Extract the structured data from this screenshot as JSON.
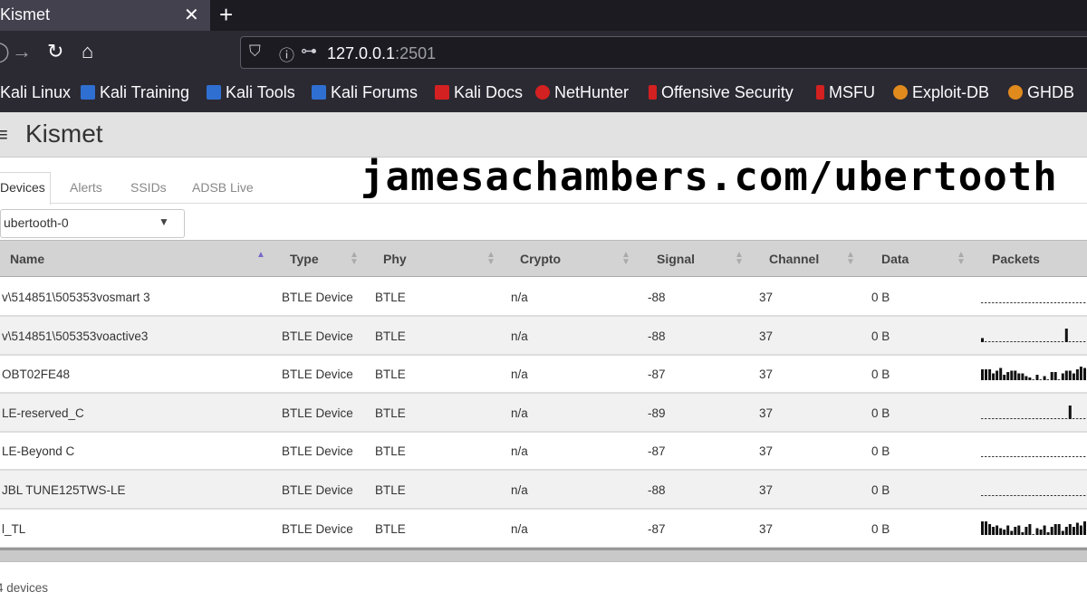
{
  "browser": {
    "tab_title": "Kismet",
    "url_host": "127.0.0.1",
    "url_port": ":2501",
    "bookmarks": [
      {
        "label": "Kali Linux",
        "icon": "none"
      },
      {
        "label": "Kali Training",
        "icon": "kali-dragon-icon"
      },
      {
        "label": "Kali Tools",
        "icon": "kali-dragon-icon"
      },
      {
        "label": "Kali Forums",
        "icon": "kali-dragon-icon"
      },
      {
        "label": "Kali Docs",
        "icon": "red-docs-icon"
      },
      {
        "label": "NetHunter",
        "icon": "nethunter-icon"
      },
      {
        "label": "Offensive Security",
        "icon": "offsec-icon"
      },
      {
        "label": "MSFU",
        "icon": "offsec-icon"
      },
      {
        "label": "Exploit-DB",
        "icon": "exploit-db-icon"
      },
      {
        "label": "GHDB",
        "icon": "exploit-db-icon"
      }
    ]
  },
  "app": {
    "title": "Kismet",
    "tabs": [
      "Devices",
      "Alerts",
      "SSIDs",
      "ADSB Live"
    ],
    "active_tab": "Devices",
    "watermark": "jamesachambers.com/ubertooth",
    "source": "ubertooth-0",
    "device_count": "4 devices"
  },
  "table": {
    "columns": [
      "Name",
      "Type",
      "Phy",
      "Crypto",
      "Signal",
      "Channel",
      "Data",
      "Packets"
    ],
    "sorted_column": "Name",
    "rows": [
      {
        "name": "v\\514851\\505353vosmart 3",
        "type": "BTLE Device",
        "phy": "BTLE",
        "crypto": "n/a",
        "signal": "-88",
        "channel": "37",
        "data": "0 B",
        "packets": [
          0,
          0,
          0,
          0,
          0,
          0,
          0,
          0,
          0,
          0,
          0,
          0,
          0,
          0,
          0,
          0,
          0,
          0,
          0,
          0,
          0,
          0,
          0,
          0,
          0,
          0,
          0,
          0,
          0
        ]
      },
      {
        "name": "v\\514851\\505353voactive3",
        "type": "BTLE Device",
        "phy": "BTLE",
        "crypto": "n/a",
        "signal": "-88",
        "channel": "37",
        "data": "0 B",
        "packets": [
          0.3,
          0,
          0,
          0,
          0,
          0,
          0,
          0,
          0,
          0,
          0,
          0,
          0,
          0,
          0,
          0,
          0,
          0,
          0,
          0,
          0,
          0,
          0,
          1,
          0,
          0,
          0,
          0,
          0
        ]
      },
      {
        "name": "OBT02FE48",
        "type": "BTLE Device",
        "phy": "BTLE",
        "crypto": "n/a",
        "signal": "-87",
        "channel": "37",
        "data": "0 B",
        "packets": [
          0.8,
          0.8,
          0.8,
          0.5,
          0.7,
          0.9,
          0.4,
          0.6,
          0.7,
          0.7,
          0.5,
          0.5,
          0.3,
          0.2,
          0,
          0.4,
          0,
          0.3,
          0,
          0.6,
          0.6,
          0,
          0.5,
          0.7,
          0.7,
          0.5,
          0.8,
          1,
          0.9
        ]
      },
      {
        "name": "LE-reserved_C",
        "type": "BTLE Device",
        "phy": "BTLE",
        "crypto": "n/a",
        "signal": "-89",
        "channel": "37",
        "data": "0 B",
        "packets": [
          0,
          0,
          0,
          0,
          0,
          0,
          0,
          0,
          0,
          0,
          0,
          0,
          0,
          0,
          0,
          0,
          0,
          0,
          0,
          0,
          0,
          0,
          0,
          0,
          1,
          0,
          0,
          0,
          0
        ]
      },
      {
        "name": "LE-Beyond C",
        "type": "BTLE Device",
        "phy": "BTLE",
        "crypto": "n/a",
        "signal": "-87",
        "channel": "37",
        "data": "0 B",
        "packets": [
          0,
          0,
          0,
          0,
          0,
          0,
          0,
          0,
          0,
          0,
          0,
          0,
          0,
          0,
          0,
          0,
          0,
          0,
          0,
          0,
          0,
          0,
          0,
          0,
          0,
          0,
          0,
          0,
          0
        ]
      },
      {
        "name": "JBL TUNE125TWS-LE",
        "type": "BTLE Device",
        "phy": "BTLE",
        "crypto": "n/a",
        "signal": "-88",
        "channel": "37",
        "data": "0 B",
        "packets": [
          0,
          0,
          0,
          0,
          0,
          0,
          0,
          0,
          0,
          0,
          0,
          0,
          0,
          0,
          0,
          0,
          0,
          0,
          0,
          0,
          0,
          0,
          0,
          0,
          0,
          0,
          0,
          0,
          0
        ]
      },
      {
        "name": "l_TL",
        "type": "BTLE Device",
        "phy": "BTLE",
        "crypto": "n/a",
        "signal": "-87",
        "channel": "37",
        "data": "0 B",
        "packets": [
          1,
          1,
          0.8,
          0.6,
          0.7,
          0.5,
          0.4,
          0.7,
          0.3,
          0.6,
          0.7,
          0.2,
          0.6,
          0.8,
          0,
          0.5,
          0.4,
          0.7,
          0.2,
          0.6,
          0.8,
          0.8,
          0.3,
          0.6,
          0.8,
          0.6,
          0.9,
          0.7,
          1
        ]
      }
    ]
  },
  "colors": {
    "tab_bar": "#1c1b22",
    "toolbar": "#2b2a33",
    "header_bg": "#e2e2e2",
    "table_header": "#d3d3d3",
    "sort_active": "#7b68c9"
  }
}
